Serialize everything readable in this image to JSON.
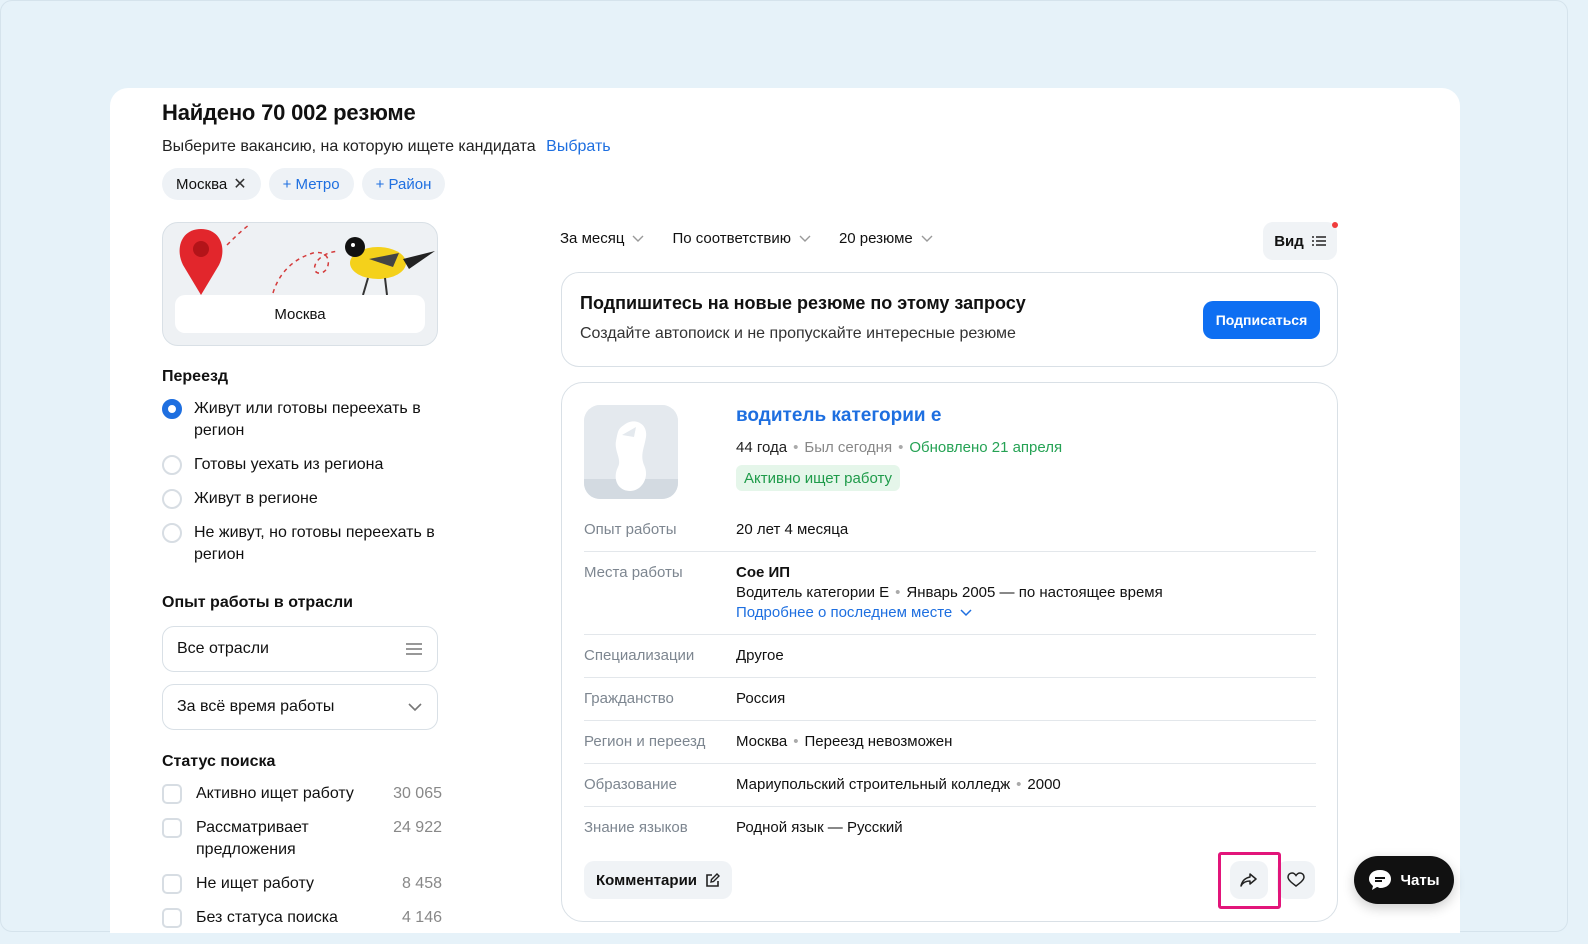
{
  "header": {
    "title": "Найдено 70 002 резюме",
    "subtitle": "Выберите вакансию, на которую ищете кандидата",
    "choose_link": "Выбрать"
  },
  "chips": {
    "city": "Москва",
    "metro": "+ Метро",
    "district": "+ Район"
  },
  "map": {
    "label": "Москва"
  },
  "relocation": {
    "title": "Переезд",
    "options": [
      "Живут или готовы переехать в регион",
      "Готовы уехать из региона",
      "Живут в регионе",
      "Не живут, но готовы переехать в регион"
    ]
  },
  "industry": {
    "title": "Опыт работы в отрасли",
    "industries_value": "Все отрасли",
    "period_value": "За всё время работы"
  },
  "search_status": {
    "title": "Статус поиска",
    "items": [
      {
        "label": "Активно ищет работу",
        "count": "30 065"
      },
      {
        "label": "Рассматривает предложения",
        "count": "24 922"
      },
      {
        "label": "Не ищет работу",
        "count": "8 458"
      },
      {
        "label": "Без статуса поиска",
        "count": "4 146"
      }
    ]
  },
  "sort": {
    "period": "За месяц",
    "order": "По соответствию",
    "per_page": "20 резюме",
    "view": "Вид"
  },
  "subscribe": {
    "title": "Подпишитесь на новые резюме по этому запросу",
    "text": "Создайте автопоиск и не пропускайте интересные резюме",
    "button": "Подписаться"
  },
  "resume": {
    "title": "водитель категории е",
    "age": "44 года",
    "last_seen": "Был сегодня",
    "updated": "Обновлено 21 апреля",
    "badge": "Активно ищет работу",
    "rows": {
      "experience_label": "Опыт работы",
      "experience_value": "20 лет 4 месяца",
      "workplaces_label": "Места работы",
      "company": "Сое ИП",
      "position": "Водитель категории Е",
      "period": "Январь 2005 — по настоящее время",
      "more_link": "Подробнее о последнем месте",
      "spec_label": "Специализации",
      "spec_value": "Другое",
      "citizenship_label": "Гражданство",
      "citizenship_value": "Россия",
      "region_label": "Регион и переезд",
      "region_city": "Москва",
      "region_relocation": "Переезд невозможен",
      "education_label": "Образование",
      "education_place": "Мариупольский строительный колледж",
      "education_year": "2000",
      "languages_label": "Знание языков",
      "languages_value": "Родной язык — Русский"
    },
    "comments_button": "Комментарии"
  },
  "chat": {
    "label": "Чаты"
  },
  "colors": {
    "accent": "#1e6fe0",
    "button_blue": "#0e6ff2",
    "green": "#25a254",
    "highlight": "#e2157a"
  }
}
